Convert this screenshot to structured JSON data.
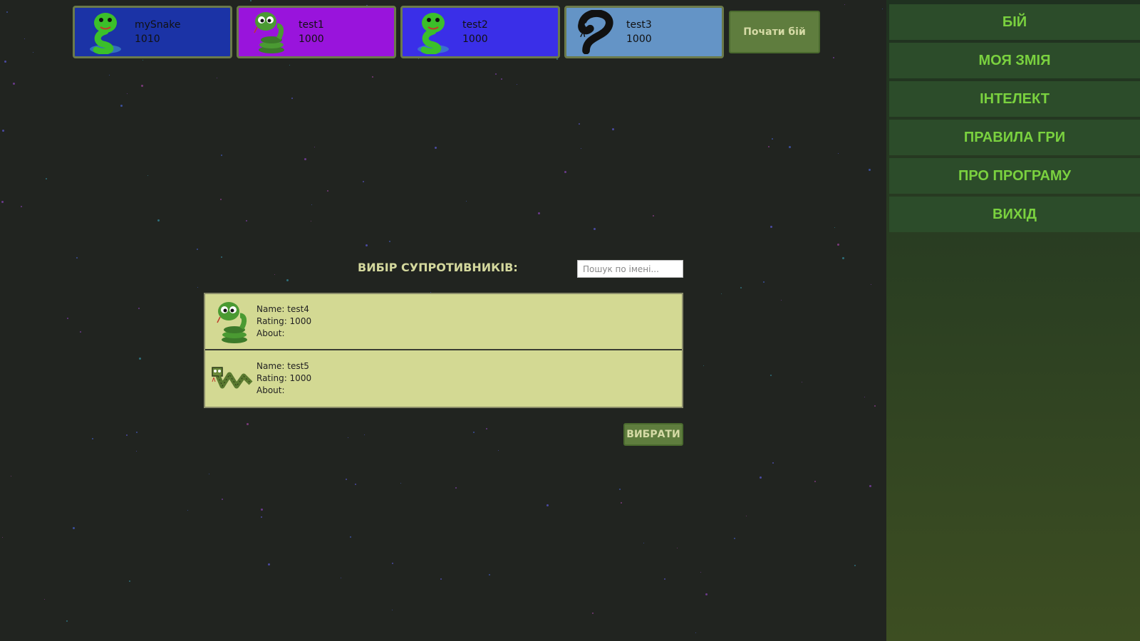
{
  "players": [
    {
      "name": "mySnake",
      "rating": "1010",
      "color": "#1b33a6",
      "icon": "green-snake-icon"
    },
    {
      "name": "test1",
      "rating": "1000",
      "color": "#9914dc",
      "icon": "coiled-snake-icon"
    },
    {
      "name": "test2",
      "rating": "1000",
      "color": "#3a2fe8",
      "icon": "green-snake-icon"
    },
    {
      "name": "test3",
      "rating": "1000",
      "color": "#6494c6",
      "icon": "black-snake-icon"
    }
  ],
  "start_button": "Почати бій",
  "menu": [
    {
      "label": "БІЙ"
    },
    {
      "label": "МОЯ ЗМІЯ"
    },
    {
      "label": "ІНТЕЛЕКТ"
    },
    {
      "label": "ПРАВИЛА ГРИ"
    },
    {
      "label": "ПРО ПРОГРАМУ"
    },
    {
      "label": "ВИХІД"
    }
  ],
  "opponents": {
    "title": "ВИБІР СУПРОТИВНИКІВ:",
    "search_placeholder": "Пошук по імені...",
    "list": [
      {
        "name_line": "Name: test4",
        "rating_line": "Rating: 1000",
        "about_line": "About:",
        "icon": "coiled-snake-icon"
      },
      {
        "name_line": "Name: test5",
        "rating_line": "Rating: 1000",
        "about_line": "About:",
        "icon": "zigzag-snake-icon"
      }
    ],
    "choose_button": "ВИБРАТИ"
  },
  "colors": {
    "background": "#212420",
    "sidebar_accent": "#7ad13f",
    "button_bg": "#5f7d3e",
    "list_bg": "#d3d993"
  }
}
